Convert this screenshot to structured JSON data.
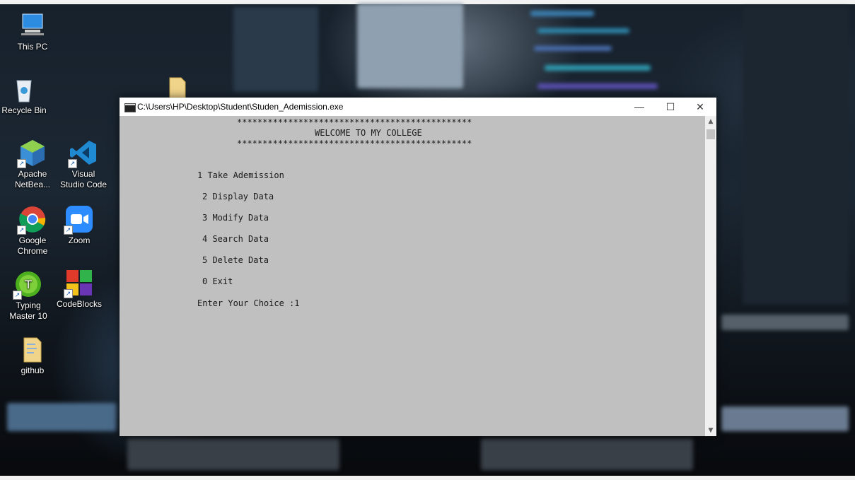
{
  "desktop": {
    "icons": [
      {
        "label": "This PC",
        "icon": "this-pc-icon"
      },
      {
        "label": "Recycle Bin",
        "icon": "recycle-bin-icon"
      },
      {
        "label": "Apache NetBea...",
        "icon": "netbeans-icon"
      },
      {
        "label": "Visual Studio Code",
        "icon": "vscode-icon"
      },
      {
        "label": "Google Chrome",
        "icon": "chrome-icon"
      },
      {
        "label": "Zoom",
        "icon": "zoom-icon"
      },
      {
        "label": "Typing Master 10",
        "icon": "typing-master-icon"
      },
      {
        "label": "CodeBlocks",
        "icon": "codeblocks-icon"
      },
      {
        "label": "github",
        "icon": "folder-icon"
      }
    ]
  },
  "window": {
    "title": "C:\\Users\\HP\\Desktop\\Student\\Studen_Ademission.exe",
    "controls": {
      "minimize": "—",
      "maximize": "☐",
      "close": "✕"
    }
  },
  "console": {
    "stars_top": "**********************************************",
    "welcome": "WELCOME TO MY COLLEGE",
    "stars_bottom": "**********************************************",
    "menu": [
      "1 Take Ademission",
      "2 Display Data",
      "3 Modify Data",
      "4 Search Data",
      "5 Delete Data",
      "0 Exit"
    ],
    "prompt": "Enter Your Choice :1"
  },
  "scrollbar": {
    "up": "▲",
    "down": "▼"
  },
  "colors": {
    "console_bg": "#c0c0c0",
    "console_text": "#1a1a1a",
    "titlebar_bg": "#ffffff"
  }
}
